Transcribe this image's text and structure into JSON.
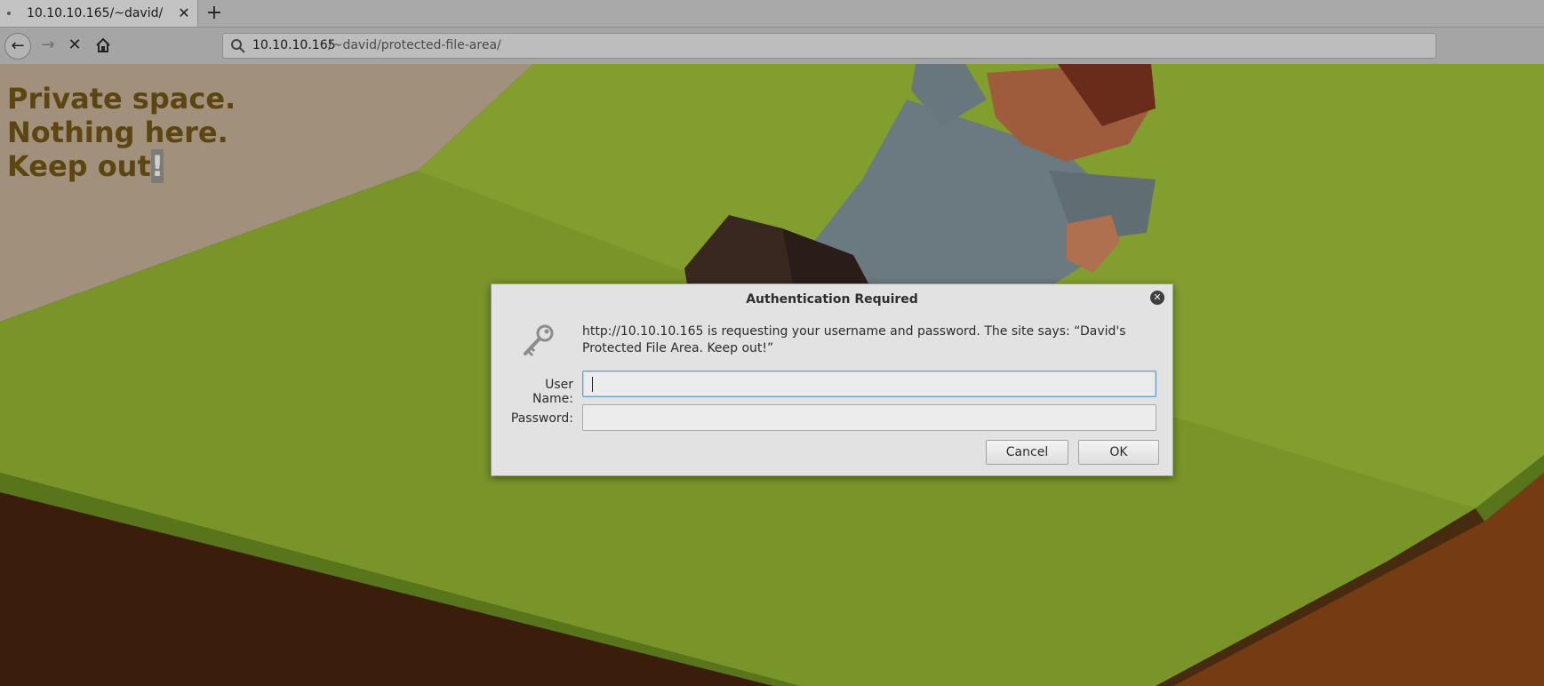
{
  "browser": {
    "tab": {
      "title": "10.10.10.165/~david/"
    },
    "url": {
      "host": "10.10.10.165",
      "path": "/~david/protected-file-area/"
    },
    "icons": {
      "tab_close": "close-icon",
      "new_tab": "plus-icon",
      "back": "arrow-left-icon",
      "forward": "arrow-right-icon",
      "stop": "stop-icon",
      "home": "home-icon",
      "search": "search-icon"
    }
  },
  "page": {
    "headline": [
      "Private space.",
      "Nothing here.",
      "Keep out",
      "!"
    ]
  },
  "dialog": {
    "title": "Authentication Required",
    "message": "http://10.10.10.165 is requesting your username and password. The site says: “David's Protected File Area. Keep out!”",
    "username_label": "User Name:",
    "username_value": "",
    "password_label": "Password:",
    "password_value": "",
    "cancel_label": "Cancel",
    "ok_label": "OK",
    "icon": "key-icon"
  }
}
